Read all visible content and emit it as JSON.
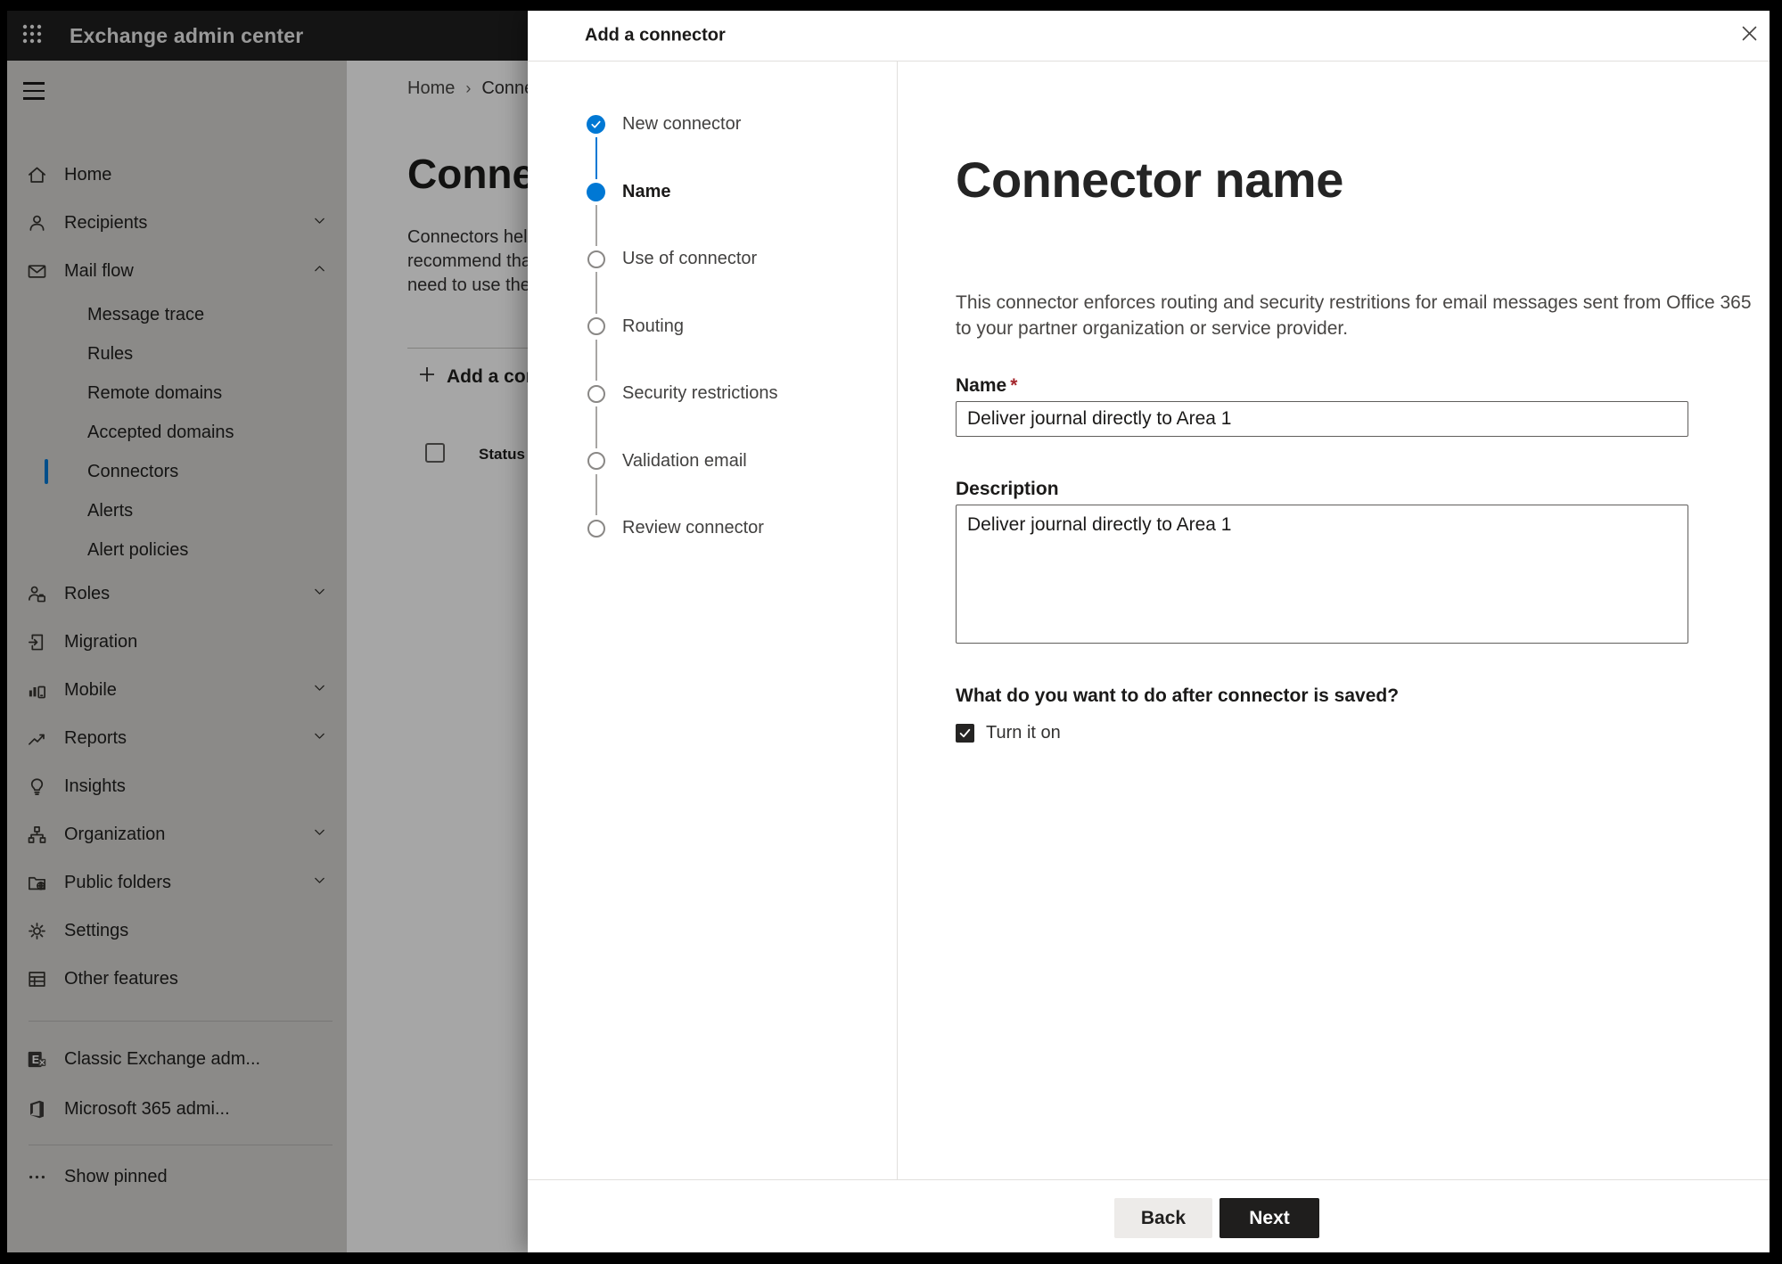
{
  "topbar": {
    "title": "Exchange admin center"
  },
  "sidebar": {
    "items": [
      {
        "label": "Home",
        "icon": "home-icon",
        "type": "top"
      },
      {
        "label": "Recipients",
        "icon": "person-icon",
        "type": "top",
        "chevron": "down"
      },
      {
        "label": "Mail flow",
        "icon": "mail-icon",
        "type": "top",
        "chevron": "up"
      },
      {
        "label": "Message trace",
        "type": "sub"
      },
      {
        "label": "Rules",
        "type": "sub"
      },
      {
        "label": "Remote domains",
        "type": "sub"
      },
      {
        "label": "Accepted domains",
        "type": "sub"
      },
      {
        "label": "Connectors",
        "type": "sub",
        "selected": true
      },
      {
        "label": "Alerts",
        "type": "sub"
      },
      {
        "label": "Alert policies",
        "type": "sub"
      },
      {
        "label": "Roles",
        "icon": "person-briefcase-icon",
        "type": "top",
        "chevron": "down"
      },
      {
        "label": "Migration",
        "icon": "migration-icon",
        "type": "top"
      },
      {
        "label": "Mobile",
        "icon": "mobile-chart-icon",
        "type": "top",
        "chevron": "down"
      },
      {
        "label": "Reports",
        "icon": "line-chart-icon",
        "type": "top",
        "chevron": "down"
      },
      {
        "label": "Insights",
        "icon": "lightbulb-icon",
        "type": "top"
      },
      {
        "label": "Organization",
        "icon": "org-chart-icon",
        "type": "top",
        "chevron": "down"
      },
      {
        "label": "Public folders",
        "icon": "folder-globe-icon",
        "type": "top",
        "chevron": "down"
      },
      {
        "label": "Settings",
        "icon": "gear-icon",
        "type": "top"
      },
      {
        "label": "Other features",
        "icon": "grid-icon",
        "type": "top"
      },
      {
        "type": "divider"
      },
      {
        "label": "Classic Exchange adm...",
        "icon": "exchange-logo-icon",
        "type": "short"
      },
      {
        "label": "Microsoft 365 admi...",
        "icon": "office-logo-icon",
        "type": "short"
      },
      {
        "type": "divider2"
      },
      {
        "label": "Show pinned",
        "icon": "ellipsis-icon",
        "type": "pinned"
      }
    ]
  },
  "background_page": {
    "breadcrumb": {
      "home": "Home",
      "separator": "›",
      "current": "Conne"
    },
    "heading": "Connec",
    "paragraph_lines": [
      "Connectors help",
      "recommend that",
      "need to use ther"
    ],
    "add_button_label": "Add a conn",
    "table_header_status": "Status"
  },
  "modal": {
    "title": "Add a connector",
    "steps": [
      {
        "label": "New connector",
        "state": "completed"
      },
      {
        "label": "Name",
        "state": "current"
      },
      {
        "label": "Use of connector",
        "state": "upcoming"
      },
      {
        "label": "Routing",
        "state": "upcoming"
      },
      {
        "label": "Security restrictions",
        "state": "upcoming"
      },
      {
        "label": "Validation email",
        "state": "upcoming"
      },
      {
        "label": "Review connector",
        "state": "upcoming"
      }
    ],
    "content": {
      "heading": "Connector name",
      "description_lines": [
        "This connector enforces routing and security restritions for email messages sent from Office 365",
        "to your partner organization or service provider."
      ],
      "name_label": "Name",
      "required_mark": "*",
      "name_value": "Deliver journal directly to Area 1",
      "description_label": "Description",
      "description_value": "Deliver journal directly to Area 1",
      "after_save_question": "What do you want to do after connector is saved?",
      "turn_on_label": "Turn it on",
      "turn_on_checked": true
    },
    "footer": {
      "back_label": "Back",
      "next_label": "Next"
    }
  },
  "colors": {
    "accent": "#0078d4",
    "required": "#a4262c",
    "next_button_bg": "#1f1e1d",
    "overlay": "rgba(0,0,0,0.35)"
  }
}
